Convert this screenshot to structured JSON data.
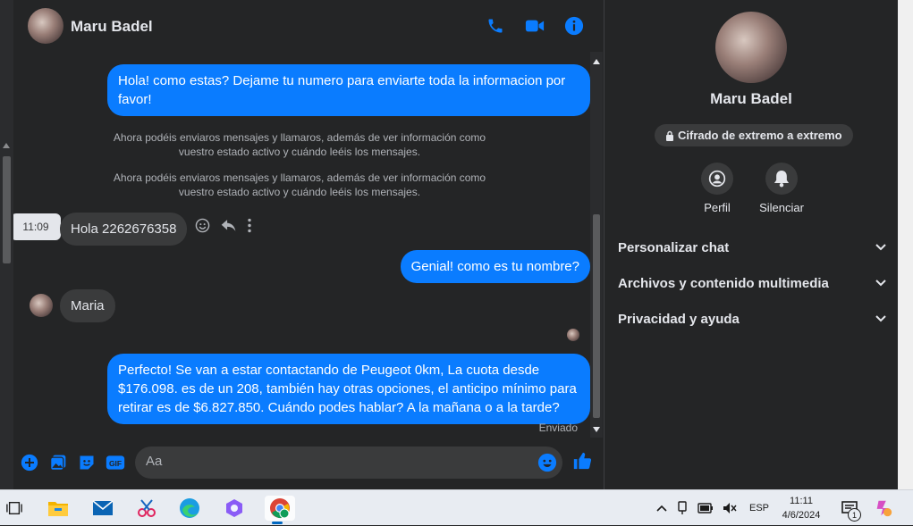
{
  "header": {
    "name": "Maru Badel"
  },
  "messages": {
    "out1": "Hola! como estas? Dejame tu numero para enviarte toda la informacion por favor!",
    "sys1": "Ahora podéis enviaros mensajes y llamaros, además de ver información como vuestro estado activo y cuándo leéis los mensajes.",
    "sys2": "Ahora podéis enviaros mensajes y llamaros, además de ver información como vuestro estado activo y cuándo leéis los mensajes.",
    "tooltip_time": "11:09",
    "in1": "Hola 2262676358",
    "out2": "Genial! como es tu nombre?",
    "in2": "Maria",
    "out3": "Perfecto!  Se van a estar contactando de Peugeot 0km, La cuota desde $176.098. es de un 208, también hay otras opciones, el anticipo mínimo para retirar es de $6.827.850. Cuándo podes hablar? A la mañana o a la tarde?",
    "status": "Enviado"
  },
  "composer": {
    "placeholder": "Aa",
    "value": ""
  },
  "info": {
    "name": "Maru Badel",
    "encryption": "Cifrado de extremo a extremo",
    "actions": {
      "profile": "Perfil",
      "mute": "Silenciar"
    },
    "sections": [
      "Personalizar chat",
      "Archivos y contenido multimedia",
      "Privacidad y ayuda"
    ]
  },
  "taskbar": {
    "lang": "ESP",
    "time": "11:11",
    "date": "4/6/2024",
    "notif_count": "1"
  },
  "colors": {
    "accent": "#0a7cff",
    "background": "#242526",
    "bubble_in": "#3a3b3c"
  }
}
